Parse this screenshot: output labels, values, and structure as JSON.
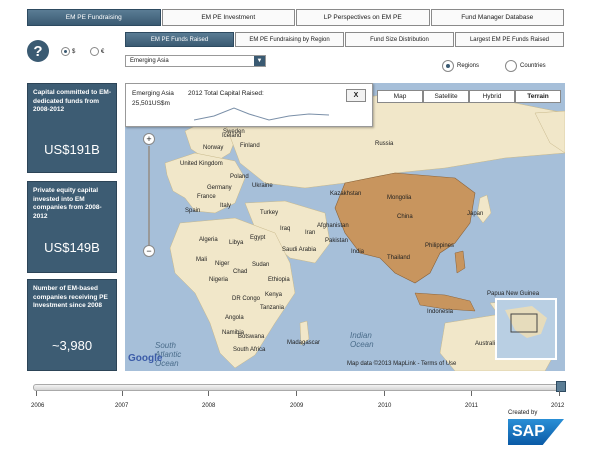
{
  "top_tabs": [
    "EM PE Fundraising",
    "EM PE Investment",
    "LP Perspectives on EM PE",
    "Fund Manager Database"
  ],
  "currency": {
    "dollar": "$",
    "euro": "€"
  },
  "sub_tabs": [
    "EM PE Funds Raised",
    "EM PE Fundraising by Region",
    "Fund Size Distribution",
    "Largest EM PE Funds Raised"
  ],
  "dropdown": {
    "value": "Emerging Asia"
  },
  "view_toggle": {
    "regions": "Regions",
    "countries": "Countries"
  },
  "stats": [
    {
      "desc": "Capital committed to EM-dedicated funds from 2008-2012",
      "value": "US$191B"
    },
    {
      "desc": "Private equity capital invested into EM companies from 2008-2012",
      "value": "US$149B"
    },
    {
      "desc": "Number of EM-based companies receiving PE Investment since 2008",
      "value": "~3,980"
    }
  ],
  "tooltip": {
    "region": "Emerging Asia",
    "label": "2012 Total Capital Raised:",
    "value": "25,501US$m",
    "close": "X"
  },
  "map_types": [
    "Map",
    "Satellite",
    "Hybrid",
    "Terrain"
  ],
  "map_labels": {
    "iceland": "Iceland",
    "sweden": "Sweden",
    "norway": "Norway",
    "finland": "Finland",
    "russia": "Russia",
    "uk": "United Kingdom",
    "germany": "Germany",
    "poland": "Poland",
    "ukraine": "Ukraine",
    "kazakhstan": "Kazakhstan",
    "france": "France",
    "spain": "Spain",
    "italy": "Italy",
    "turkey": "Turkey",
    "mongolia": "Mongolia",
    "algeria": "Algeria",
    "libya": "Libya",
    "egypt": "Egypt",
    "iraq": "Iraq",
    "iran": "Iran",
    "afghanistan": "Afghanistan",
    "china": "China",
    "japan": "Japan",
    "saudi": "Saudi Arabia",
    "pakistan": "Pakistan",
    "india": "India",
    "mali": "Mali",
    "niger": "Niger",
    "chad": "Chad",
    "sudan": "Sudan",
    "thailand": "Thailand",
    "philippines": "Philippines",
    "nigeria": "Nigeria",
    "ethiopia": "Ethiopia",
    "kenya": "Kenya",
    "drc": "DR Congo",
    "tanzania": "Tanzania",
    "angola": "Angola",
    "namibia": "Namibia",
    "botswana": "Botswana",
    "madagascar": "Madagascar",
    "indonesia": "Indonesia",
    "png": "Papua New Guinea",
    "south_africa": "South Africa",
    "australia": "Australia"
  },
  "ocean_labels": {
    "south_atlantic": "South Atlantic Ocean",
    "indian": "Indian Ocean"
  },
  "google_logo": "Google",
  "attribution": "Map data ©2013  MapLink - Terms of Use",
  "timeline": {
    "years": [
      "2006",
      "2007",
      "2008",
      "2009",
      "2010",
      "2011",
      "2012"
    ],
    "selected": "2012"
  },
  "footer": {
    "created_by": "Created by",
    "sap": "SAP"
  },
  "colors": {
    "accent": "#3d5c73",
    "highlight_region": "#c8955e",
    "ocean": "#a6bfd9",
    "land": "#f1e7c9"
  }
}
